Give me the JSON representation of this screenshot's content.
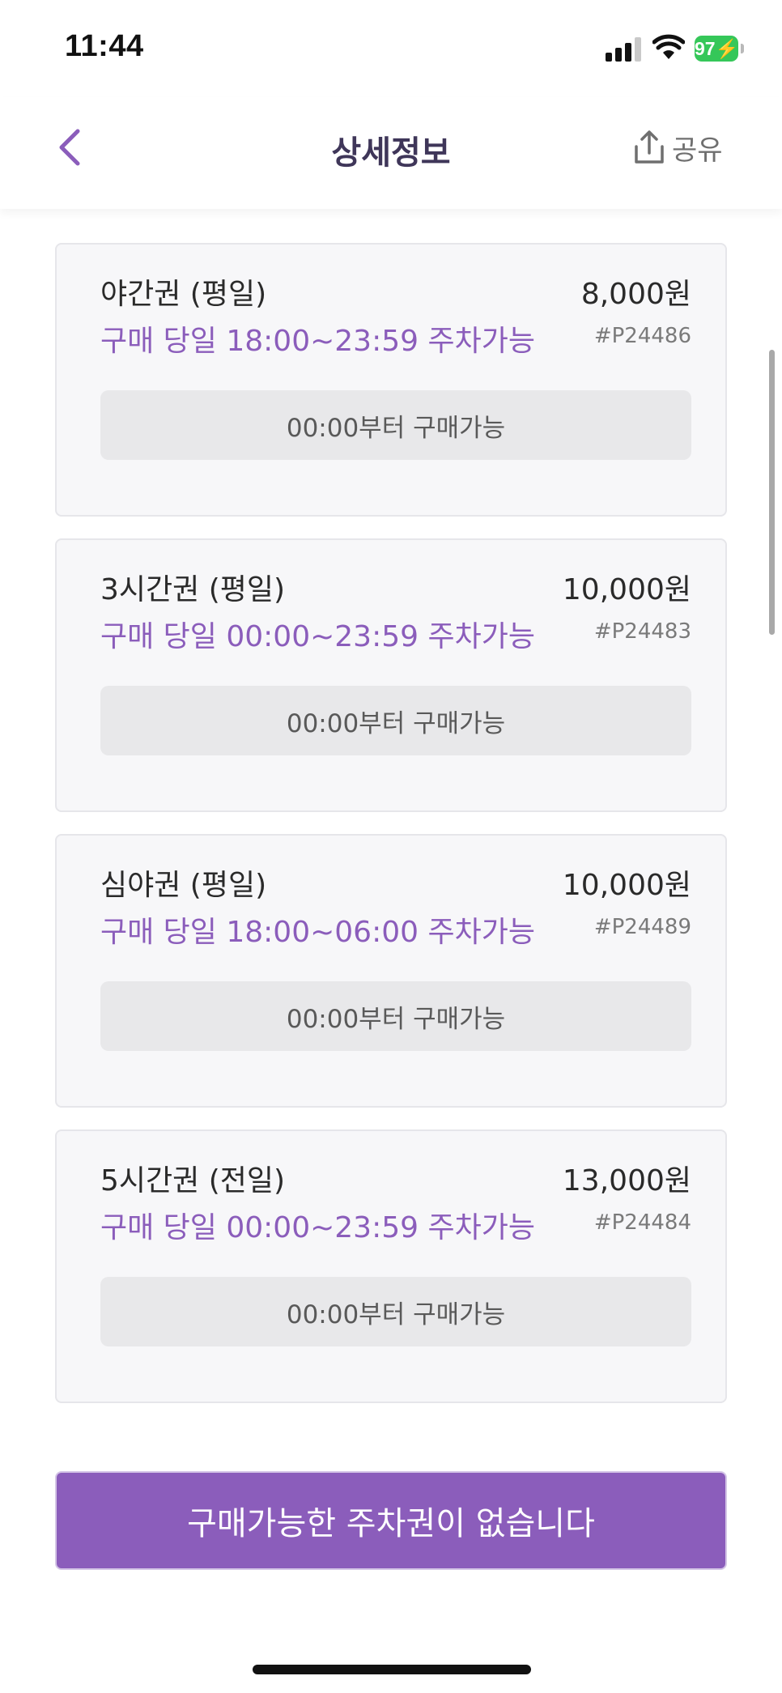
{
  "status_bar": {
    "time": "11:44",
    "battery": "97",
    "icons": [
      "signal-icon",
      "wifi-icon",
      "battery-icon"
    ]
  },
  "header": {
    "title": "상세정보",
    "share_label": "공유",
    "icons": [
      "chevron-left-icon",
      "share-icon"
    ]
  },
  "colors": {
    "accent": "#8b5dbb",
    "title": "#3f3659",
    "card_background": "#f7f7f9",
    "disabled_button": "#e8e8ea"
  },
  "tickets": [
    {
      "name": "야간권 (평일)",
      "price": "8,000원",
      "hours": "구매 당일 18:00~23:59 주차가능",
      "code": "#P24486",
      "availability": "00:00부터 구매가능"
    },
    {
      "name": "3시간권 (평일)",
      "price": "10,000원",
      "hours": "구매 당일 00:00~23:59 주차가능",
      "code": "#P24483",
      "availability": "00:00부터 구매가능"
    },
    {
      "name": "심야권 (평일)",
      "price": "10,000원",
      "hours": "구매 당일 18:00~06:00 주차가능",
      "code": "#P24489",
      "availability": "00:00부터 구매가능"
    },
    {
      "name": "5시간권 (전일)",
      "price": "13,000원",
      "hours": "구매 당일 00:00~23:59 주차가능",
      "code": "#P24484",
      "availability": "00:00부터 구매가능"
    }
  ],
  "purchase_button": {
    "label": "구매가능한 주차권이 없습니다"
  }
}
